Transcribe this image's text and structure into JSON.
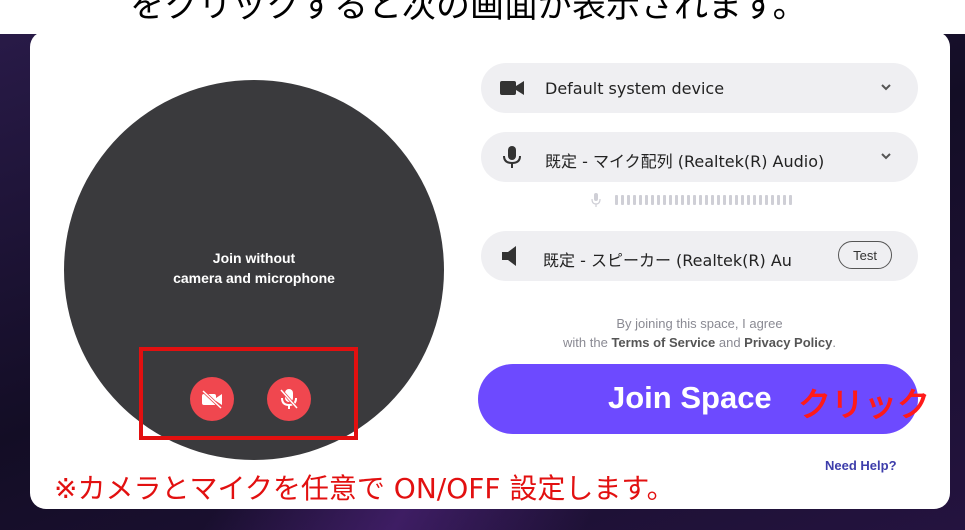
{
  "top_caption": "をクリックすると次の画面が表示されます。",
  "preview": {
    "line1": "Join without",
    "line2": "camera and microphone"
  },
  "devices": {
    "camera": {
      "label": "Default system device",
      "icon": "camera-icon"
    },
    "microphone": {
      "label": "既定 - マイク配列 (Realtek(R) Audio)",
      "icon": "microphone-icon"
    },
    "speaker": {
      "label": "既定 - スピーカー (Realtek(R) Au",
      "icon": "speaker-icon",
      "test_label": "Test"
    }
  },
  "agreement": {
    "line1": "By joining this space, I agree",
    "prefix": "with the ",
    "terms": "Terms of Service",
    "and": " and ",
    "privacy": "Privacy Policy",
    "suffix": "."
  },
  "join_button": {
    "label": "Join Space",
    "annotation": "クリック"
  },
  "need_help": "Need Help?",
  "annotation": "※カメラとマイクを任意で ON/OFF 設定します。",
  "colors": {
    "accent": "#6d4aff",
    "toggle_off": "#f0474f",
    "annotation_red": "#e21010"
  }
}
